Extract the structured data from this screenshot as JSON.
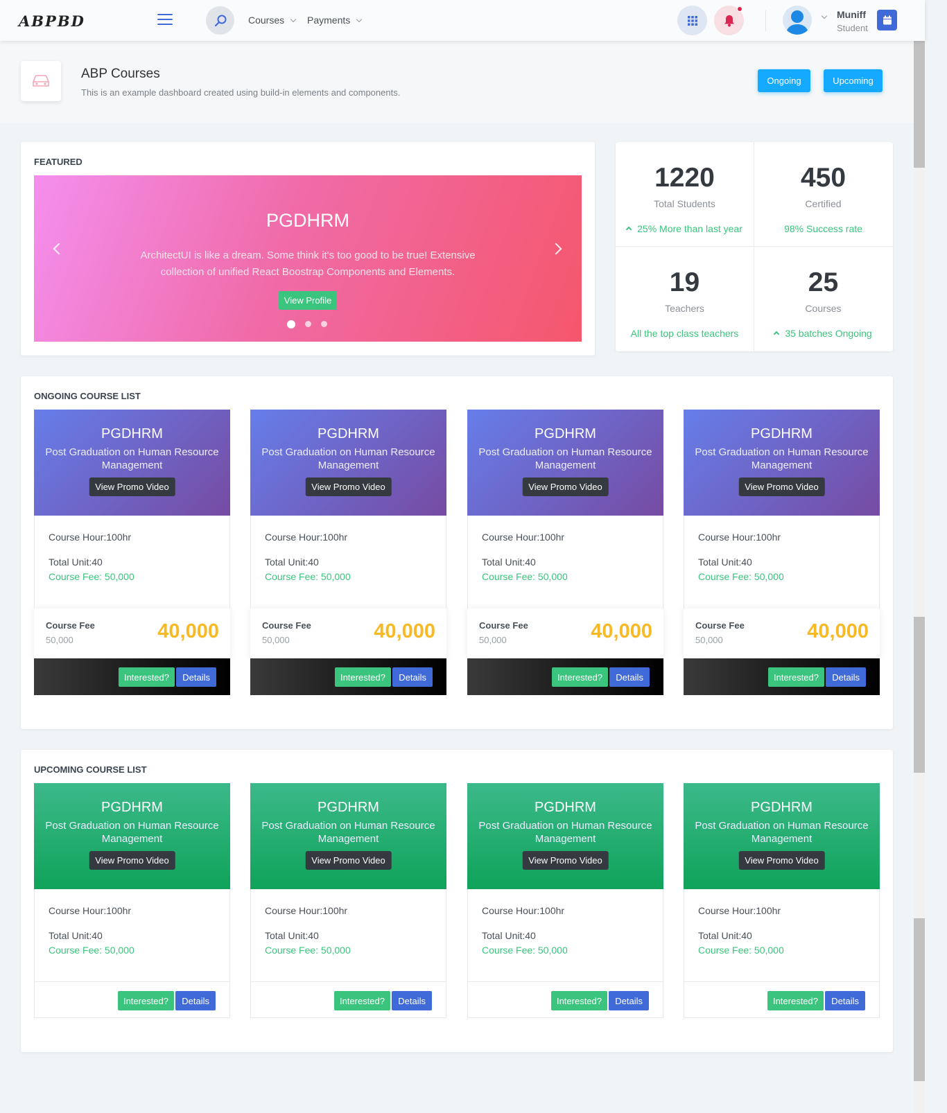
{
  "header": {
    "logo": "ABPBD",
    "nav": [
      {
        "label": "Courses"
      },
      {
        "label": "Payments"
      }
    ],
    "user": {
      "name": "Muniff",
      "role": "Student"
    }
  },
  "title_bar": {
    "title": "ABP Courses",
    "subtitle": "This is an example dashboard created using build-in elements and components.",
    "buttons": {
      "ongoing": "Ongoing",
      "upcoming": "Upcoming"
    }
  },
  "featured": {
    "title": "FEATURED",
    "slide": {
      "title": "PGDHRM",
      "text": "ArchitectUI is like a dream. Some think it's too good to be true! Extensive collection of unified React Boostrap Components and Elements.",
      "button": "View Profile",
      "active_index": 0,
      "count": 3
    }
  },
  "stats": [
    {
      "value": "1220",
      "label": "Total Students",
      "sub": "25% More than last year",
      "trend": "up"
    },
    {
      "value": "450",
      "label": "Certified",
      "sub": "98% Success rate",
      "trend": "none"
    },
    {
      "value": "19",
      "label": "Teachers",
      "sub": "All the top class teachers",
      "trend": "none"
    },
    {
      "value": "25",
      "label": "Courses",
      "sub": "35 batches Ongoing",
      "trend": "up"
    }
  ],
  "ongoing": {
    "title": "ONGOING COURSE LIST",
    "courses": [
      {
        "code": "PGDHRM",
        "name": "Post Graduation on Human Resource Management",
        "promo": "View Promo Video",
        "hour": "Course Hour:100hr",
        "unit": "Total Unit:40",
        "fee": "Course Fee: 50,000",
        "fee_label": "Course Fee",
        "old_price": "50,000",
        "new_price": "40,000",
        "interested": "Interested?",
        "details": "Details"
      },
      {
        "code": "PGDHRM",
        "name": "Post Graduation on Human Resource Management",
        "promo": "View Promo Video",
        "hour": "Course Hour:100hr",
        "unit": "Total Unit:40",
        "fee": "Course Fee: 50,000",
        "fee_label": "Course Fee",
        "old_price": "50,000",
        "new_price": "40,000",
        "interested": "Interested?",
        "details": "Details"
      },
      {
        "code": "PGDHRM",
        "name": "Post Graduation on Human Resource Management",
        "promo": "View Promo Video",
        "hour": "Course Hour:100hr",
        "unit": "Total Unit:40",
        "fee": "Course Fee: 50,000",
        "fee_label": "Course Fee",
        "old_price": "50,000",
        "new_price": "40,000",
        "interested": "Interested?",
        "details": "Details"
      },
      {
        "code": "PGDHRM",
        "name": "Post Graduation on Human Resource Management",
        "promo": "View Promo Video",
        "hour": "Course Hour:100hr",
        "unit": "Total Unit:40",
        "fee": "Course Fee: 50,000",
        "fee_label": "Course Fee",
        "old_price": "50,000",
        "new_price": "40,000",
        "interested": "Interested?",
        "details": "Details"
      }
    ]
  },
  "upcoming": {
    "title": "UPCOMING COURSE LIST",
    "courses": [
      {
        "code": "PGDHRM",
        "name": "Post Graduation on Human Resource Management",
        "promo": "View Promo Video",
        "hour": "Course Hour:100hr",
        "unit": "Total Unit:40",
        "fee": "Course Fee: 50,000",
        "interested": "Interested?",
        "details": "Details"
      },
      {
        "code": "PGDHRM",
        "name": "Post Graduation on Human Resource Management",
        "promo": "View Promo Video",
        "hour": "Course Hour:100hr",
        "unit": "Total Unit:40",
        "fee": "Course Fee: 50,000",
        "interested": "Interested?",
        "details": "Details"
      },
      {
        "code": "PGDHRM",
        "name": "Post Graduation on Human Resource Management",
        "promo": "View Promo Video",
        "hour": "Course Hour:100hr",
        "unit": "Total Unit:40",
        "fee": "Course Fee: 50,000",
        "interested": "Interested?",
        "details": "Details"
      },
      {
        "code": "PGDHRM",
        "name": "Post Graduation on Human Resource Management",
        "promo": "View Promo Video",
        "hour": "Course Hour:100hr",
        "unit": "Total Unit:40",
        "fee": "Course Fee: 50,000",
        "interested": "Interested?",
        "details": "Details"
      }
    ]
  },
  "colors": {
    "primary": "#3f6ad8",
    "info": "#16aaff",
    "success": "#3ac47d",
    "warning": "#f7b924",
    "danger": "#d92550"
  }
}
